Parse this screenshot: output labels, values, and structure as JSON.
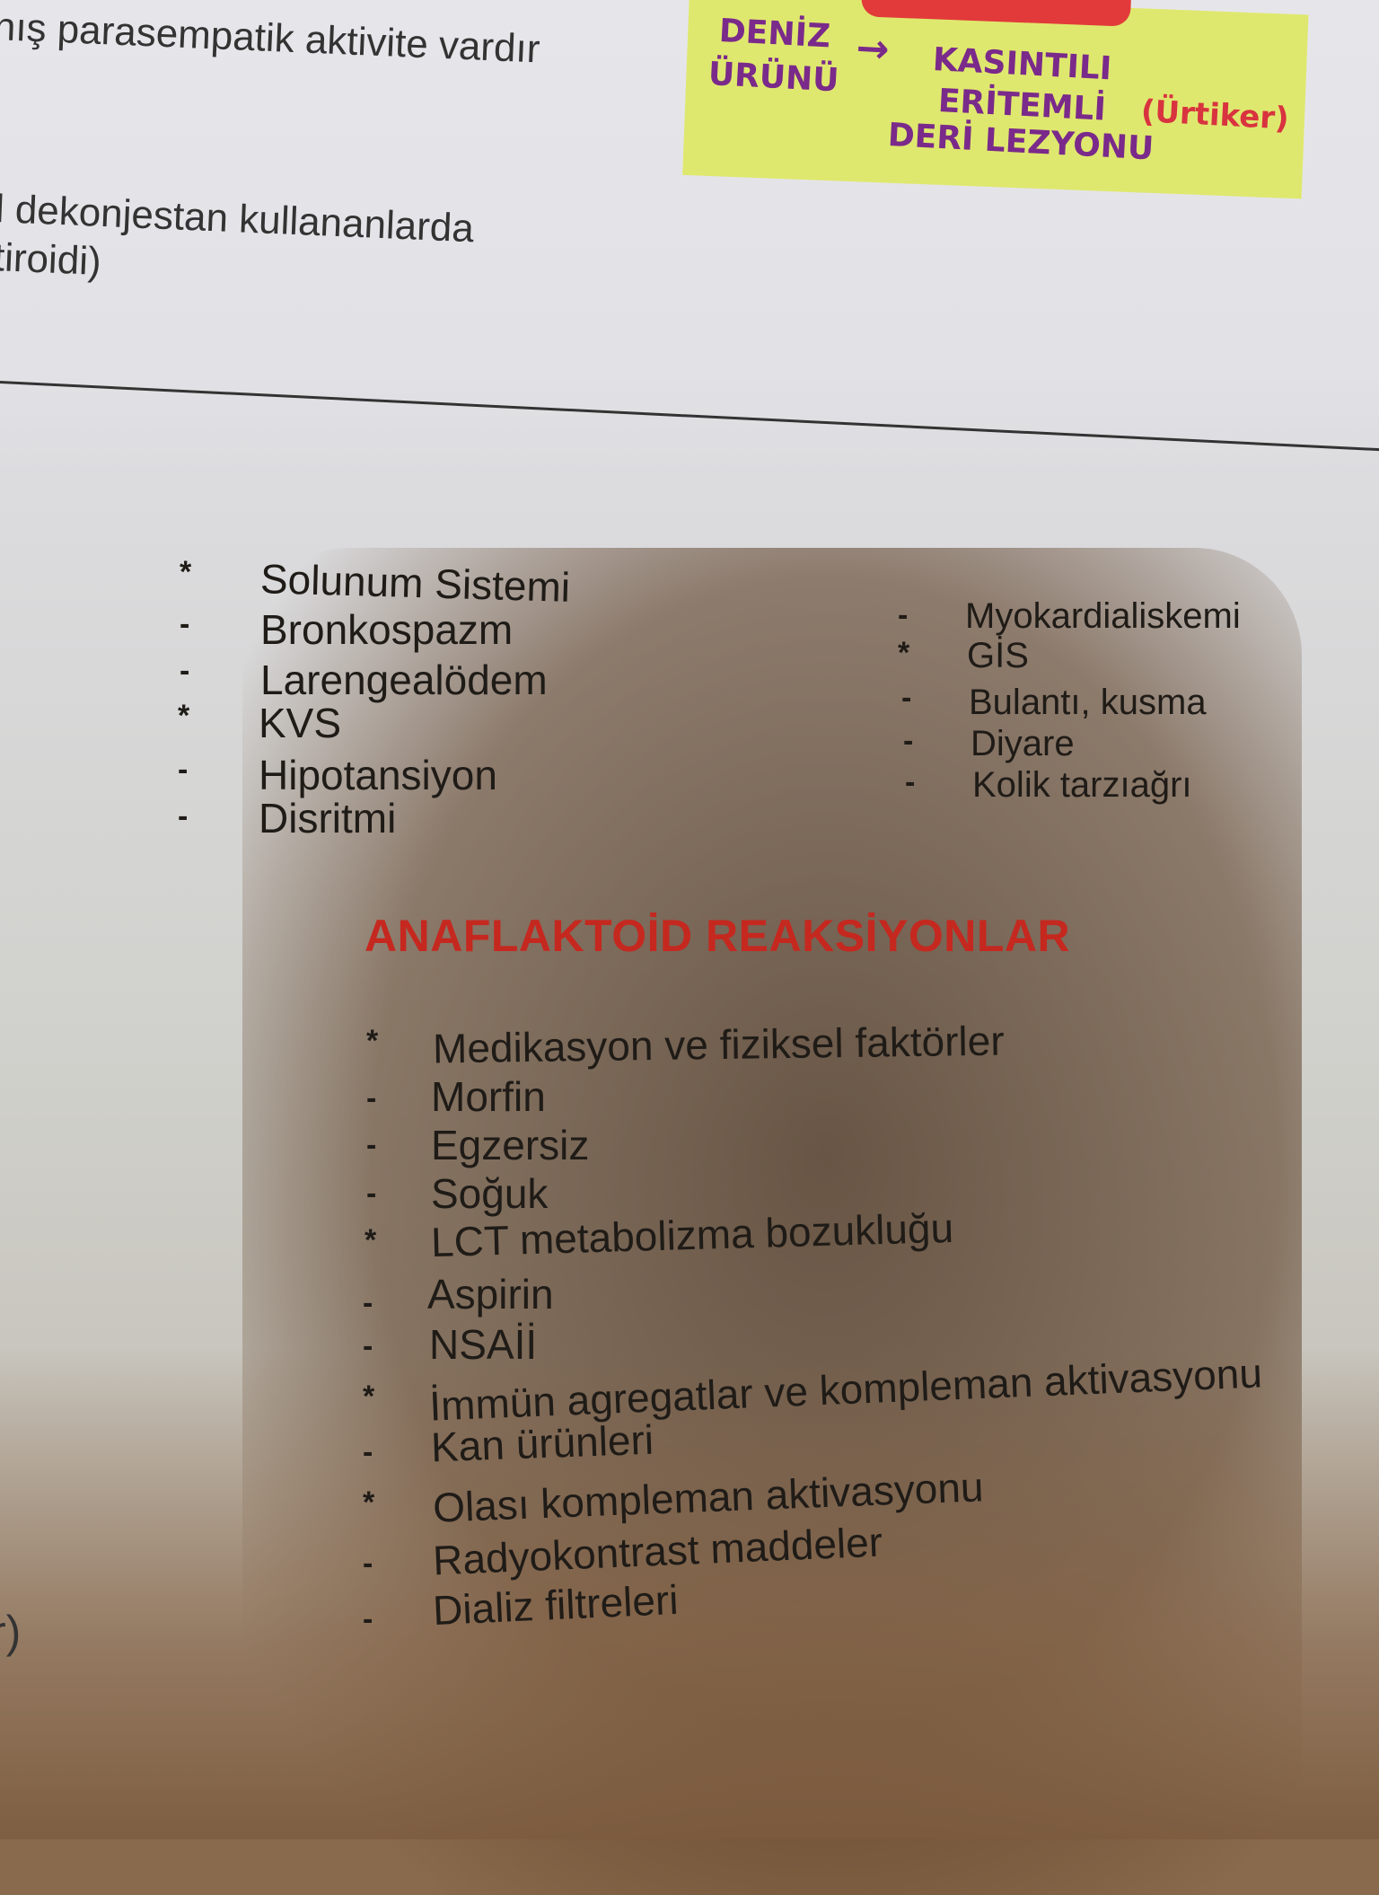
{
  "top_lines": [
    "nış parasempatik aktivite vardır",
    "l dekonjestan kullananlarda",
    "tiroidi)"
  ],
  "sticky_note": {
    "left_label_line1": "DENİZ",
    "left_label_line2": "ÜRÜNÜ",
    "arrow": "→",
    "right_line1": "KASINTILI",
    "right_line2": "ERİTEMLİ",
    "right_line3": "DERİ LEZYONU",
    "note": "(Ürtiker)"
  },
  "left_list": [
    {
      "bullet": "*",
      "text": "Solunum Sistemi"
    },
    {
      "bullet": "-",
      "text": "Bronkospazm"
    },
    {
      "bullet": "-",
      "text": "Larengealödem"
    },
    {
      "bullet": "*",
      "text": "KVS"
    },
    {
      "bullet": "-",
      "text": "Hipotansiyon"
    },
    {
      "bullet": "-",
      "text": "Disritmi"
    }
  ],
  "right_list": [
    {
      "bullet": "-",
      "text": "Myokardialiskemi"
    },
    {
      "bullet": "*",
      "text": "GİS"
    },
    {
      "bullet": "-",
      "text": "Bulantı, kusma"
    },
    {
      "bullet": "-",
      "text": "Diyare"
    },
    {
      "bullet": "-",
      "text": "Kolik tarzıağrı"
    }
  ],
  "section_heading": "ANAFLAKTOİD REAKSİYONLAR",
  "section_list": [
    {
      "bullet": "*",
      "text": "Medikasyon ve fiziksel faktörler"
    },
    {
      "bullet": "-",
      "text": "Morfin"
    },
    {
      "bullet": "-",
      "text": "Egzersiz"
    },
    {
      "bullet": "-",
      "text": "Soğuk"
    },
    {
      "bullet": "*",
      "text": "LCT metabolizma bozukluğu"
    },
    {
      "bullet": "-",
      "text": "Aspirin"
    },
    {
      "bullet": "-",
      "text": "NSAİİ"
    },
    {
      "bullet": "*",
      "text": "İmmün agregatlar ve kompleman aktivasyonu"
    },
    {
      "bullet": "-",
      "text": "Kan ürünleri"
    },
    {
      "bullet": "*",
      "text": "Olası kompleman aktivasyonu"
    },
    {
      "bullet": "-",
      "text": "Radyokontrast maddeler"
    },
    {
      "bullet": "-",
      "text": "Dializ filtreleri"
    }
  ],
  "margin_fragment": "r)"
}
